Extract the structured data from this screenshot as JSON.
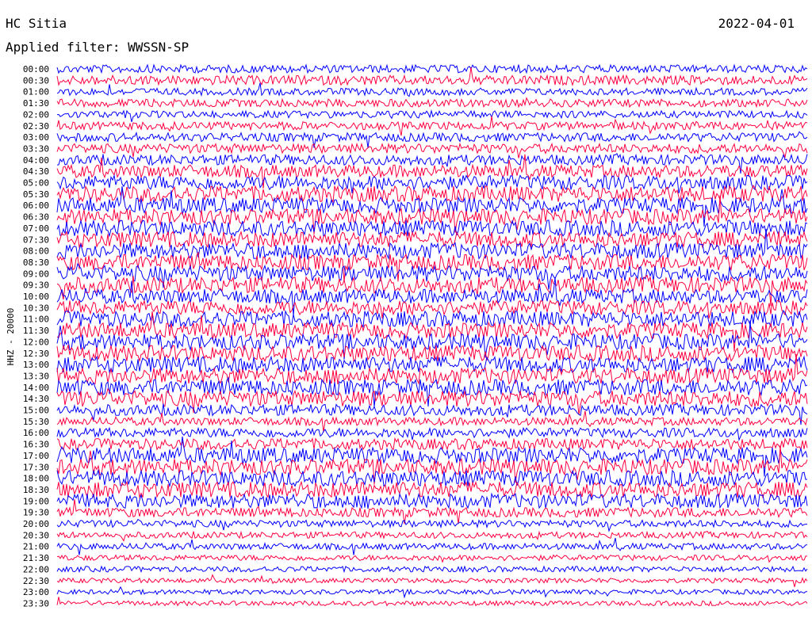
{
  "header": {
    "station": "HC Sitia",
    "date": "2022-04-01",
    "filter_label": "Applied filter: WWSSN-SP"
  },
  "chart_data": {
    "type": "line",
    "title": "HC Sitia",
    "ylabel": "HHZ - 20000",
    "row_labels": [
      "00:00",
      "00:30",
      "01:00",
      "01:30",
      "02:00",
      "02:30",
      "03:00",
      "03:30",
      "04:00",
      "04:30",
      "05:00",
      "05:30",
      "06:00",
      "06:30",
      "07:00",
      "07:30",
      "08:00",
      "08:30",
      "09:00",
      "09:30",
      "10:00",
      "10:30",
      "11:00",
      "11:30",
      "12:00",
      "12:30",
      "13:00",
      "13:30",
      "14:00",
      "14:30",
      "15:00",
      "15:30",
      "16:00",
      "16:30",
      "17:00",
      "17:30",
      "18:00",
      "18:30",
      "19:00",
      "19:30",
      "20:00",
      "20:30",
      "21:00",
      "21:30",
      "22:00",
      "22:30",
      "23:00",
      "23:30"
    ],
    "row_colors": [
      "#0000ff",
      "#ff0040"
    ],
    "amplitude_by_row": [
      0.5,
      0.6,
      0.45,
      0.5,
      0.45,
      0.5,
      0.55,
      0.6,
      0.65,
      0.8,
      0.9,
      1.0,
      1.0,
      1.0,
      1.0,
      1.0,
      1.0,
      1.0,
      1.0,
      1.0,
      0.9,
      0.9,
      1.0,
      1.0,
      1.0,
      1.0,
      1.0,
      1.0,
      1.0,
      1.0,
      0.7,
      0.5,
      0.6,
      0.7,
      1.0,
      1.0,
      1.0,
      1.0,
      0.9,
      0.6,
      0.45,
      0.4,
      0.4,
      0.35,
      0.35,
      0.3,
      0.3,
      0.3
    ]
  }
}
